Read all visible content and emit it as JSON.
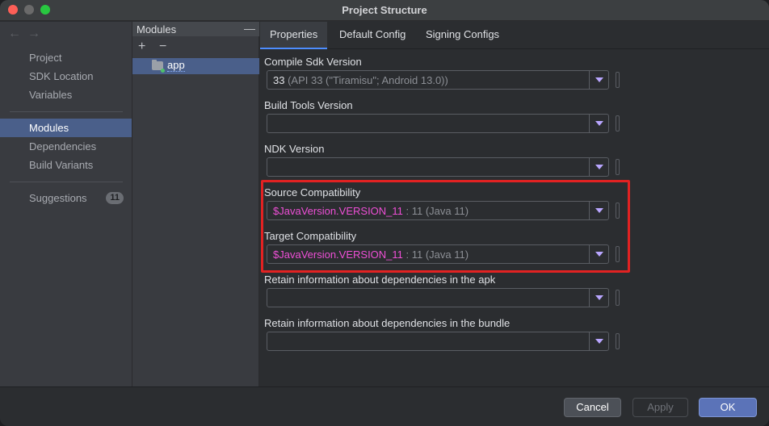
{
  "window": {
    "title": "Project Structure"
  },
  "nav": {
    "back_icon": "arrow-left-icon",
    "forward_icon": "arrow-right-icon",
    "items": [
      {
        "label": "Project"
      },
      {
        "label": "SDK Location"
      },
      {
        "label": "Variables"
      },
      {
        "label": "Modules",
        "selected": true
      },
      {
        "label": "Dependencies"
      },
      {
        "label": "Build Variants"
      },
      {
        "label": "Suggestions",
        "badge": "11"
      }
    ]
  },
  "modules": {
    "header": "Modules",
    "add_icon": "+",
    "remove_icon": "−",
    "collapse_icon": "—",
    "items": [
      {
        "label": "app",
        "icon": "module-folder-icon"
      }
    ]
  },
  "tabs": [
    {
      "label": "Properties",
      "active": true
    },
    {
      "label": "Default Config"
    },
    {
      "label": "Signing Configs"
    }
  ],
  "fields": {
    "compile_sdk": {
      "label": "Compile Sdk Version",
      "value_main": "33",
      "value_dim": " (API 33 (\"Tiramisu\"; Android 13.0))"
    },
    "build_tools": {
      "label": "Build Tools Version",
      "value": ""
    },
    "ndk": {
      "label": "NDK Version",
      "value": ""
    },
    "source_compat": {
      "label": "Source Compatibility",
      "value_var": "$JavaVersion.VERSION_11",
      "value_dim": " : 11 (Java 11)"
    },
    "target_compat": {
      "label": "Target Compatibility",
      "value_var": "$JavaVersion.VERSION_11",
      "value_dim": " : 11 (Java 11)"
    },
    "deps_apk": {
      "label": "Retain information about dependencies in the apk",
      "value": ""
    },
    "deps_bundle": {
      "label": "Retain information about dependencies in the bundle",
      "value": ""
    }
  },
  "buttons": {
    "cancel": "Cancel",
    "apply": "Apply",
    "ok": "OK"
  },
  "colors": {
    "accent": "#4d8dff",
    "selection": "#4a5f8a",
    "highlight": "#e22222",
    "variable_text": "#ee4fd6"
  }
}
